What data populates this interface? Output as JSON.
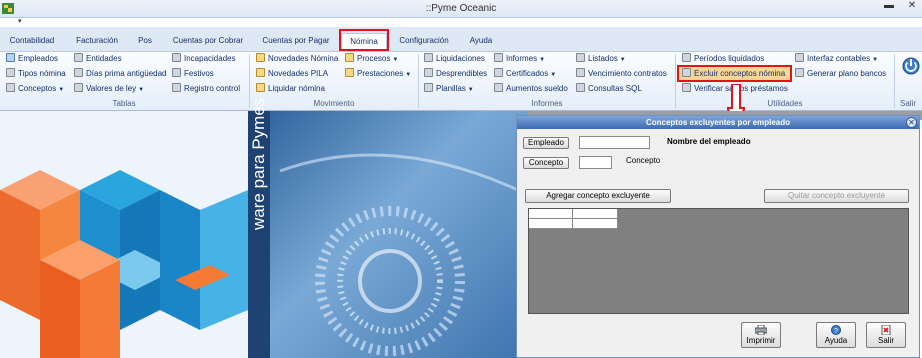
{
  "window": {
    "title": "::Pyme Oceanic",
    "quick_access": "▾",
    "minimize": "▬",
    "close": "✕"
  },
  "tabs": [
    {
      "label": "Contabilidad"
    },
    {
      "label": "Facturación"
    },
    {
      "label": "Pos"
    },
    {
      "label": "Cuentas por Cobrar"
    },
    {
      "label": "Cuentas por Pagar"
    },
    {
      "label": "Nómina"
    },
    {
      "label": "Configuración"
    },
    {
      "label": "Ayuda"
    }
  ],
  "ribbon": {
    "tablas": {
      "label": "Tablas",
      "items": [
        "Empleados",
        "Tipos nómina",
        "Conceptos",
        "Entidades",
        "Días prima antigüedad",
        "Valores de ley",
        "Incapacidades",
        "Festivos",
        "Registro control"
      ]
    },
    "movimiento": {
      "label": "Movimiento",
      "items": [
        "Novedades Nómina",
        "Novedades PILA",
        "Liquidar nómina",
        "Procesos",
        "Prestaciones"
      ]
    },
    "informes": {
      "label": "Informes",
      "items": [
        "Liquidaciones",
        "Desprendibles",
        "Planillas",
        "Informes",
        "Certificados",
        "Aumentos sueldo",
        "Listados",
        "Vencimiento contratos",
        "Consultas SQL"
      ]
    },
    "utilidades": {
      "label": "Utilidades",
      "items": [
        "Períodos liquidados",
        "Excluir conceptos nómina",
        "Verificar saldos préstamos",
        "Interfaz contables",
        "Generar plano bancos"
      ]
    },
    "salir": {
      "label": "Salir"
    }
  },
  "splash": {
    "vertical_text": "ware para Pymes"
  },
  "dialog": {
    "title": "Conceptos excluyentes por empleado",
    "empleado_button": "Empleado",
    "empleado_value": "",
    "nombre_label": "Nombre del empleado",
    "concepto_button": "Concepto",
    "concepto_value": "",
    "concepto_label": "Concepto",
    "agregar_button": "Agregar concepto excluyente",
    "quitar_button": "Quitar concepto excluyente",
    "footer": [
      "Imprimir",
      "Ayuda",
      "Salir"
    ],
    "close": "✕"
  },
  "colors": {
    "highlight": "#e0141a",
    "ribbon_text": "#15306b",
    "dialog_title": "#3a6bb3"
  }
}
